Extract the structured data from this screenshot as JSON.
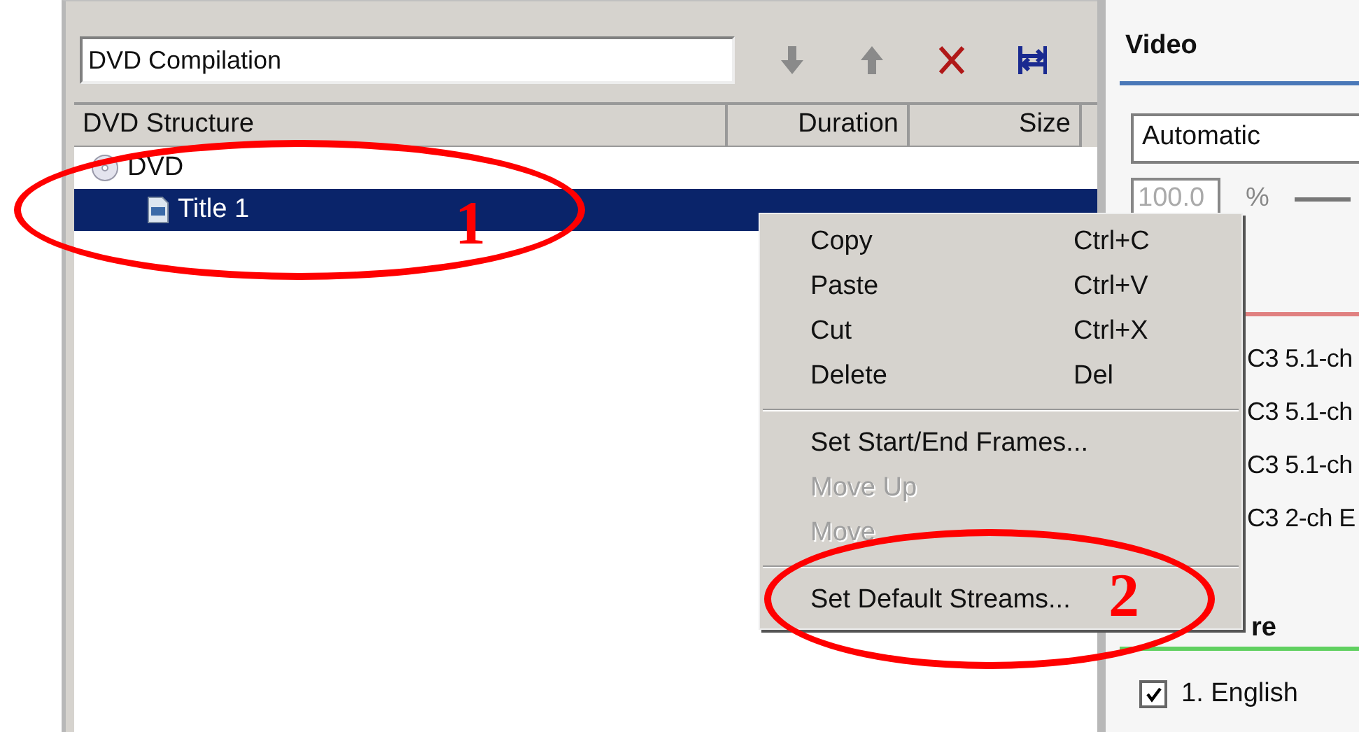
{
  "compilation_field": {
    "value": "DVD Compilation"
  },
  "toolbar": [
    {
      "kind": "down"
    },
    {
      "kind": "up"
    },
    {
      "kind": "delete"
    },
    {
      "kind": "fit"
    }
  ],
  "table": {
    "columns": [
      "DVD Structure",
      "Duration",
      "Size"
    ],
    "tree": [
      {
        "label": "DVD",
        "kind": "disc",
        "selected": false,
        "children": [
          {
            "label": "Title 1",
            "kind": "title",
            "selected": true
          }
        ]
      }
    ]
  },
  "context_menu": [
    {
      "kind": "item",
      "label": "Copy",
      "shortcut": "Ctrl+C",
      "disabled": false
    },
    {
      "kind": "item",
      "label": "Paste",
      "shortcut": "Ctrl+V",
      "disabled": false
    },
    {
      "kind": "item",
      "label": "Cut",
      "shortcut": "Ctrl+X",
      "disabled": false
    },
    {
      "kind": "item",
      "label": "Delete",
      "shortcut": "Del",
      "disabled": false
    },
    {
      "kind": "separator"
    },
    {
      "kind": "item",
      "label": "Set Start/End Frames...",
      "disabled": false
    },
    {
      "kind": "item",
      "label": "Move Up",
      "disabled": true
    },
    {
      "kind": "item",
      "label": "Move",
      "disabled": true
    },
    {
      "kind": "separator"
    },
    {
      "kind": "item",
      "label": "Set Default Streams...",
      "disabled": false
    }
  ],
  "video": {
    "title": "Video",
    "mode": "Automatic",
    "scale": "100.0",
    "unit": "%"
  },
  "audio_streams": [
    "C3 5.1-ch",
    "C3 5.1-ch",
    "C3 5.1-ch",
    "C3 2-ch E"
  ],
  "subtitle_heading": "re",
  "subtitles": [
    {
      "label": "1. English",
      "checked": true
    }
  ],
  "annotations": [
    {
      "label": "1"
    },
    {
      "label": "2"
    }
  ]
}
